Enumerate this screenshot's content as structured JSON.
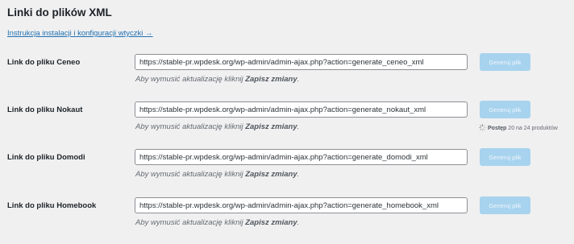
{
  "section": {
    "title": "Linki do plików XML",
    "instructions_link": "Instrukcja instalacji i konfiguracji wtyczki →"
  },
  "hint": {
    "prefix": "Aby wymusić aktualizację kliknij",
    "strong": "Zapisz zmiany",
    "suffix": "."
  },
  "button_label": "Generuj plik",
  "rows": [
    {
      "label": "Link do pliku Ceneo",
      "url": "https://stable-pr.wpdesk.org/wp-admin/admin-ajax.php?action=generate_ceneo_xml"
    },
    {
      "label": "Link do pliku Nokaut",
      "url": "https://stable-pr.wpdesk.org/wp-admin/admin-ajax.php?action=generate_nokaut_xml",
      "progress": {
        "label": "Postęp",
        "text": "20 na 24 produktów",
        "done": 20,
        "total": 24
      }
    },
    {
      "label": "Link do pliku Domodi",
      "url": "https://stable-pr.wpdesk.org/wp-admin/admin-ajax.php?action=generate_domodi_xml"
    },
    {
      "label": "Link do pliku Homebook",
      "url": "https://stable-pr.wpdesk.org/wp-admin/admin-ajax.php?action=generate_homebook_xml"
    }
  ],
  "colors": {
    "link": "#2271b1",
    "button_disabled": "#a7d3ee",
    "background": "#f0f0f1"
  },
  "icons": {
    "progress": "spinner-icon"
  }
}
